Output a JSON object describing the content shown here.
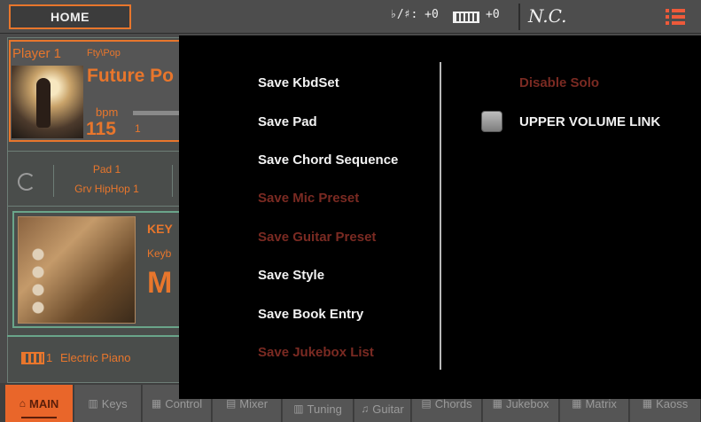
{
  "topbar": {
    "home_label": "HOME",
    "transpose_text": "♭/♯: +0",
    "octave_text": "+0",
    "chord_text": "N.C."
  },
  "player": {
    "label": "Player 1",
    "style_category": "Fty\\Pop",
    "style_name": "Future Po",
    "bpm_label": "bpm",
    "bpm_value": "115",
    "bpm_sub": "1"
  },
  "pad": {
    "name": "Pad 1",
    "sound": "Grv HipHop 1"
  },
  "keyboard_set": {
    "title": "KEY",
    "subtitle": "Keyb",
    "name_fragment": "M"
  },
  "track": {
    "number": "1",
    "name": "Electric Piano"
  },
  "tabs": [
    {
      "label": "MAIN",
      "icon": "home-icon"
    },
    {
      "label": "Keys",
      "icon": "keys-icon"
    },
    {
      "label": "Control",
      "icon": "control-icon"
    },
    {
      "label": "Mixer",
      "icon": "mixer-icon"
    },
    {
      "label": "Tuning",
      "icon": "tuning-icon"
    },
    {
      "label": "Guitar",
      "icon": "guitar-icon"
    },
    {
      "label": "Chords",
      "icon": "chords-icon"
    },
    {
      "label": "Jukebox",
      "icon": "jukebox-icon"
    },
    {
      "label": "Matrix",
      "icon": "matrix-icon"
    },
    {
      "label": "Kaoss",
      "icon": "kaoss-icon"
    }
  ],
  "menu": {
    "items": [
      {
        "label": "Save KbdSet",
        "enabled": true
      },
      {
        "label": "Save Pad",
        "enabled": true
      },
      {
        "label": "Save Chord Sequence",
        "enabled": true
      },
      {
        "label": "Save Mic Preset",
        "enabled": false
      },
      {
        "label": "Save Guitar Preset",
        "enabled": false
      },
      {
        "label": "Save Style",
        "enabled": true
      },
      {
        "label": "Save Book Entry",
        "enabled": true
      },
      {
        "label": "Save Jukebox List",
        "enabled": false
      }
    ],
    "disable_solo": "Disable Solo",
    "upper_volume_link": "UPPER VOLUME LINK",
    "upper_volume_link_checked": false
  },
  "colors": {
    "accent": "#e8762c",
    "active_tab": "#e9662a",
    "disabled_text": "#7a2a22",
    "menu_background": "#000000"
  }
}
